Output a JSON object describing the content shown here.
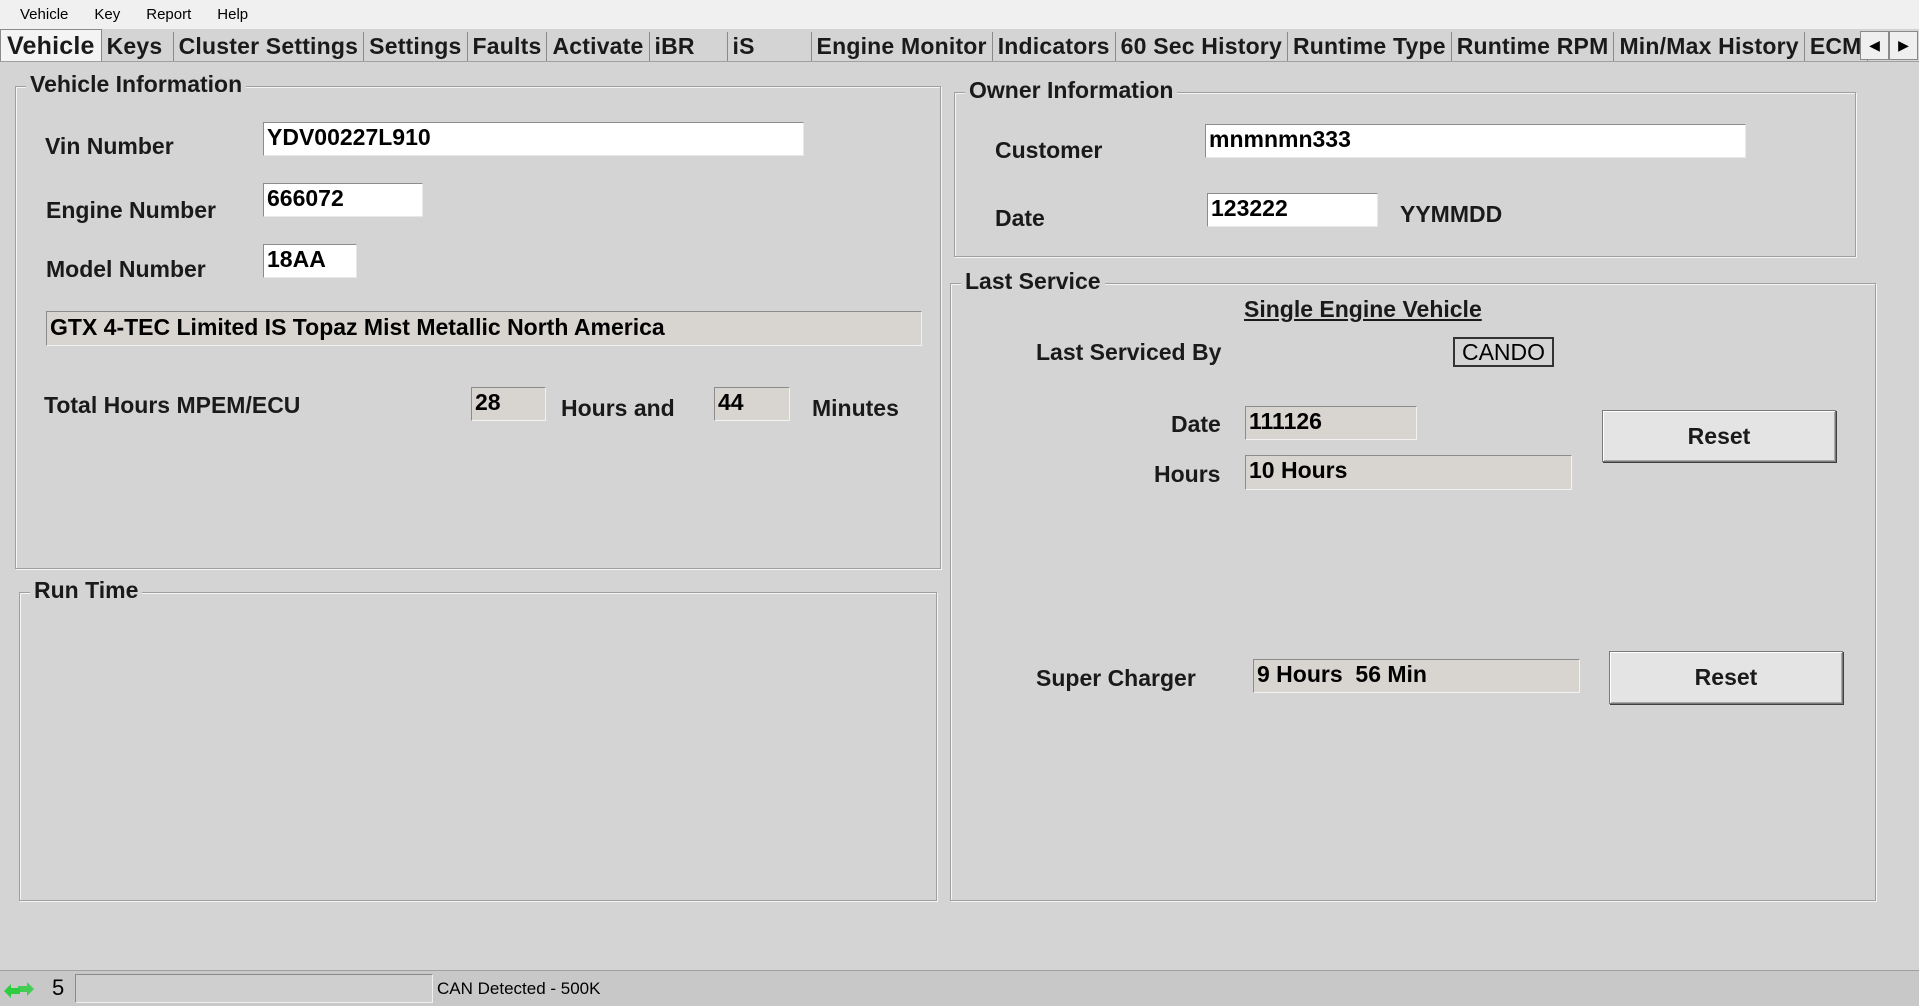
{
  "menu": [
    "Vehicle",
    "Key",
    "Report",
    "Help"
  ],
  "tabs": [
    "Vehicle",
    "Keys",
    "Cluster Settings",
    "Settings",
    "Faults",
    "Activate",
    "iBR",
    "iS",
    "Engine Monitor",
    "Indicators",
    "60 Sec History",
    "Runtime Type",
    "Runtime RPM",
    "Min/Max History",
    "ECM"
  ],
  "active_tab": "Vehicle",
  "vehicle_info": {
    "title": "Vehicle Information",
    "vin_label": "Vin Number",
    "vin": "YDV00227L910",
    "engine_label": "Engine Number",
    "engine": "666072",
    "model_label": "Model Number",
    "model": "18AA",
    "description": "GTX 4-TEC Limited IS Topaz Mist Metallic North America",
    "total_hours_label": "Total Hours MPEM/ECU",
    "hours": "28",
    "hours_and_label": "Hours and",
    "minutes": "44",
    "minutes_label": "Minutes"
  },
  "run_time": {
    "title": "Run Time"
  },
  "owner_info": {
    "title": "Owner Information",
    "customer_label": "Customer",
    "customer": "mnmnmn333",
    "date_label": "Date",
    "date": "123222",
    "date_format": "YYMMDD"
  },
  "last_service": {
    "title": "Last Service",
    "heading": "Single Engine Vehicle",
    "serviced_by_label": "Last Serviced By",
    "serviced_by": "CANDO",
    "date_label": "Date",
    "date": "111126",
    "hours_label": "Hours",
    "hours": "10 Hours",
    "reset_label": "Reset",
    "supercharger_label": "Super Charger",
    "supercharger": "9 Hours  56 Min",
    "supercharger_reset_label": "Reset"
  },
  "status": {
    "count": "5",
    "text": "CAN Detected - 500K"
  },
  "colors": {
    "background": "#d4d4d4",
    "field_white": "#ffffff",
    "field_readonly": "#d8d4cf",
    "status_icon": "#2ecc40"
  },
  "icons": {
    "tab_scroll_left": "triangle-left-icon",
    "tab_scroll_right": "triangle-right-icon",
    "status_connection": "connection-arrows-icon"
  }
}
